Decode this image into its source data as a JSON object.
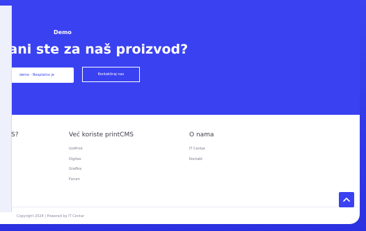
{
  "hero": {
    "eyebrow": "Demo",
    "title": "vani ste za naš proizvod?",
    "primary_button": "demo - Besplatno je",
    "secondary_button": "Kontaktiraj nas"
  },
  "footer": {
    "col1_title_tail": "S?",
    "col2": {
      "title": "Već koriste printCMS",
      "links": [
        "UniPrint",
        "Digitex",
        "Grafika",
        "Forum"
      ]
    },
    "col3": {
      "title": "O nama",
      "links": [
        "IT Centar",
        "Kontakt"
      ]
    },
    "copyright": "Copyright 2024 | Powered by IT Centar"
  },
  "colors": {
    "brand": "#3a41f1",
    "background": "#2d34e8",
    "card": "#ffffff"
  },
  "icons": {
    "scroll_top": "chevron-up-icon"
  }
}
